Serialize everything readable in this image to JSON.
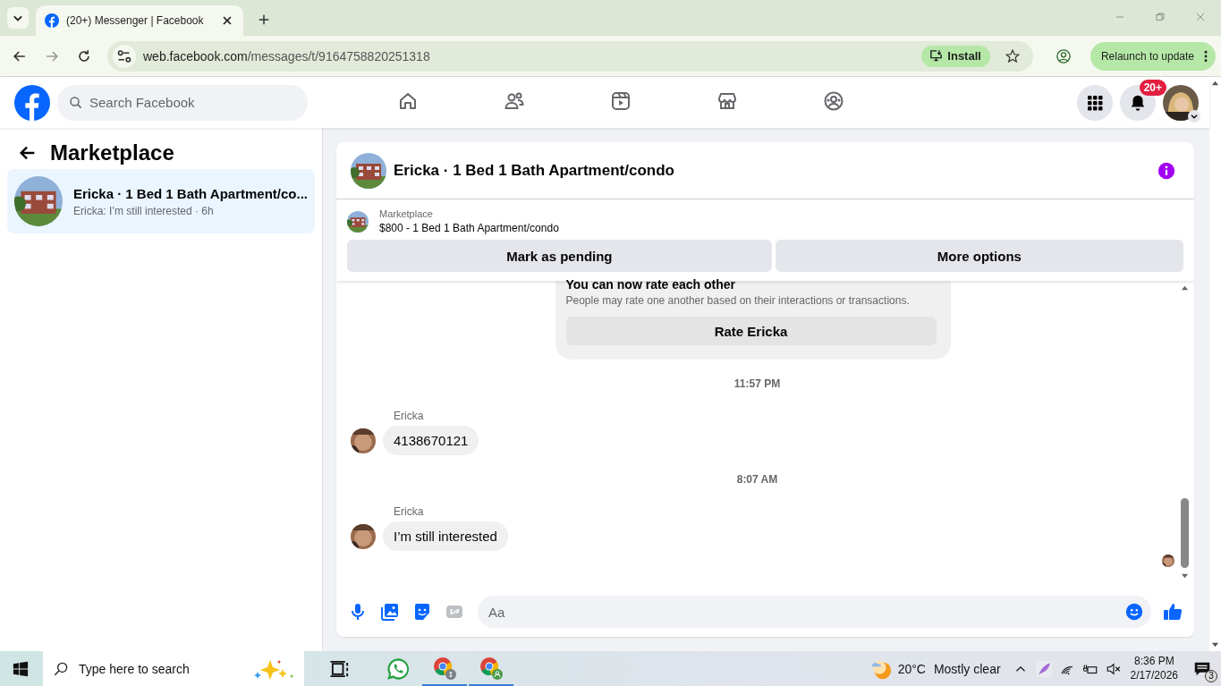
{
  "browser": {
    "tab_title": "(20+) Messenger | Facebook",
    "url_domain": "web.facebook.com",
    "url_path": "/messages/t/9164758820251318",
    "install": "Install",
    "relaunch": "Relaunch to update"
  },
  "header": {
    "search_placeholder": "Search Facebook",
    "nav": [
      {
        "kind": "home",
        "selected": false
      },
      {
        "kind": "friends",
        "selected": false
      },
      {
        "kind": "video",
        "selected": false
      },
      {
        "kind": "marketplace",
        "selected": false
      },
      {
        "kind": "groups",
        "selected": false
      }
    ],
    "notification_badge": "20+"
  },
  "sidebar": {
    "title": "Marketplace",
    "conversations": [
      {
        "title": "Ericka · 1 Bed 1 Bath Apartment/co...",
        "preview": "Ericka: I’m still interested · 6h",
        "selected": true
      }
    ]
  },
  "chat": {
    "title": "Ericka · 1 Bed 1 Bath Apartment/condo",
    "listing": {
      "label": "Marketplace",
      "title": "$800 - 1 Bed 1 Bath Apartment/condo",
      "buttons": [
        "Mark as pending",
        "More options"
      ]
    },
    "messages": [
      {
        "kind": "card",
        "title": "You can now rate each other",
        "text": "People may rate one another based on their interactions or transactions.",
        "button": "Rate Ericka"
      },
      {
        "kind": "time",
        "text": "11:57 PM"
      },
      {
        "kind": "message",
        "sender": "Ericka",
        "text": "4138670121"
      },
      {
        "kind": "time",
        "text": "8:07 AM"
      },
      {
        "kind": "message",
        "sender": "Ericka",
        "text": "I’m still interested"
      }
    ],
    "composer": {
      "placeholder": "Aa"
    }
  },
  "taskbar": {
    "search_placeholder": "Type here to search",
    "weather_temp": "20°C",
    "weather_text": "Mostly clear",
    "time": "8:36 PM",
    "date": "2/17/2026",
    "notification_count": "3"
  }
}
